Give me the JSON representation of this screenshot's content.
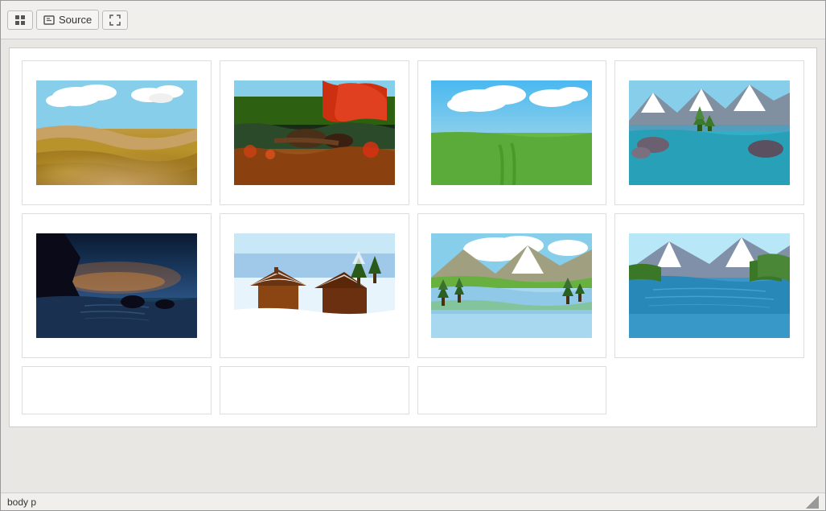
{
  "toolbar": {
    "grid_btn_label": "Grid View",
    "source_btn_label": "Source",
    "fullscreen_btn_label": "Fullscreen"
  },
  "images": [
    {
      "id": 1,
      "type": "desert",
      "alt": "Desert landscape with sand dunes"
    },
    {
      "id": 2,
      "type": "autumn",
      "alt": "Autumn forest with lake"
    },
    {
      "id": 3,
      "type": "meadow",
      "alt": "Green meadow with blue sky"
    },
    {
      "id": 4,
      "type": "mountain",
      "alt": "Mountain lake with turquoise water"
    },
    {
      "id": 5,
      "type": "ocean",
      "alt": "Dark ocean cliff at sunset"
    },
    {
      "id": 6,
      "type": "snow",
      "alt": "Snow cabin in winter"
    },
    {
      "id": 7,
      "type": "alpine",
      "alt": "Alpine lake with mountain reflection"
    },
    {
      "id": 8,
      "type": "blue-lake",
      "alt": "Blue mountain lake"
    },
    {
      "id": 9,
      "type": "empty",
      "alt": ""
    },
    {
      "id": 10,
      "type": "empty",
      "alt": ""
    },
    {
      "id": 11,
      "type": "empty",
      "alt": ""
    },
    {
      "id": 12,
      "type": "empty",
      "alt": ""
    }
  ],
  "status": {
    "selector": "body p"
  }
}
